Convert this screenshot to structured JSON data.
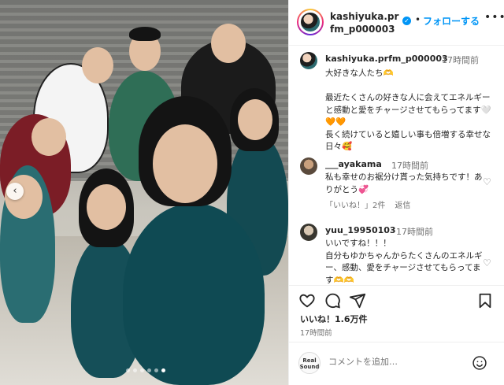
{
  "header": {
    "username": "kashiyuka.prfm_p000003",
    "separator": "•",
    "follow_label": "フォローする",
    "more_icon": "more-horizontal-icon"
  },
  "caption": {
    "username": "kashiyuka.prfm_p000003",
    "time": "17時間前",
    "text": "大好きな人たち🫶\n\n最近たくさんの好きな人に会えてエネルギーと感動と愛をチャージさせてもらってます🤍🧡🧡\n長く続けていると嬉しい事も倍増する幸せな日々🥰"
  },
  "comments": [
    {
      "username": "___ayakama",
      "time": "17時間前",
      "text": "私も幸せのお裾分け貰った気持ちです！ありがとう💞",
      "likes_label": "「いいね！」2件",
      "reply_label": "返信"
    },
    {
      "username": "yuu_19950103",
      "time": "17時間前",
      "text": "いいですね！！！\n自分もゆかちゃんからたくさんのエネルギー、感動、愛をチャージさせてもらってます🫶🫶\nいつもありがとうございます🙏🙏"
    }
  ],
  "actions": {
    "likes": "いいね！1.6万件",
    "time": "17時間前"
  },
  "add_comment": {
    "avatar_text": "Real\nSound",
    "placeholder": "コメントを追加…"
  },
  "photo": {
    "prev_arrow": "‹",
    "carousel_count": 6,
    "carousel_active": 5
  },
  "colors": {
    "accent": "#0095f6",
    "muted": "#737373",
    "text": "#262626"
  }
}
